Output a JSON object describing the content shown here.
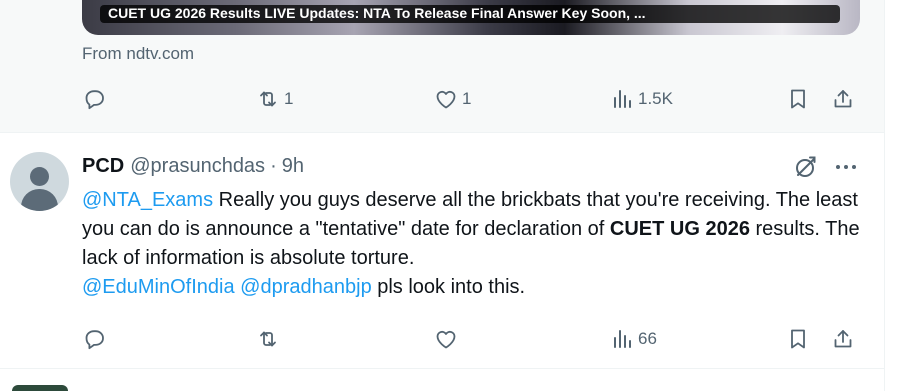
{
  "post1": {
    "card_caption": "CUET UG 2026 Results LIVE Updates: NTA To Release Final Answer Key Soon, ...",
    "card_source": "From ndtv.com",
    "actions": {
      "reply_count": "",
      "repost_count": "1",
      "like_count": "1",
      "views_count": "1.5K"
    }
  },
  "post2": {
    "display_name": "PCD",
    "handle": "@prasunchdas",
    "separator": "·",
    "time": "9h",
    "text": {
      "m1": "@NTA_Exams",
      "t1": " Really you guys deserve all the brickbats that you're receiving. The least you can do is announce a \"tentative\" date for declaration of ",
      "b1": "CUET UG 2026",
      "t2": " results. The lack of information is absolute torture. ",
      "m2": "@EduMinOfIndia",
      "t3": " ",
      "m3": "@dpradhanbjp",
      "t4": " pls look into this."
    },
    "actions": {
      "reply_count": "",
      "repost_count": "",
      "like_count": "",
      "views_count": "66"
    }
  },
  "icons": [
    "reply-icon",
    "repost-icon",
    "like-icon",
    "views-icon",
    "bookmark-icon",
    "share-icon",
    "grok-icon",
    "more-icon"
  ],
  "colors": {
    "accent": "#1d9bf0",
    "muted_text": "#536471",
    "primary_text": "#0f1419",
    "hover_bg": "#f7f9f9"
  }
}
